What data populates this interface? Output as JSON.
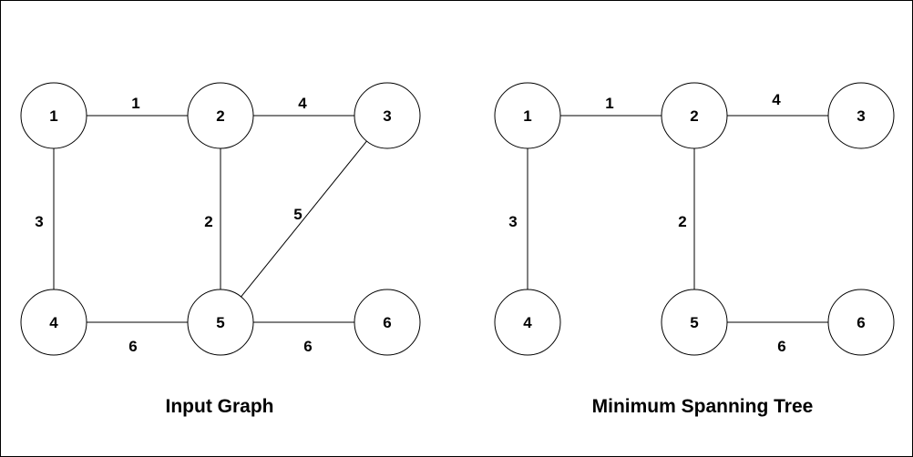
{
  "diagrams": [
    {
      "title": "Input Graph",
      "nodes": [
        "1",
        "2",
        "3",
        "4",
        "5",
        "6"
      ],
      "edges": [
        {
          "from": "1",
          "to": "2",
          "weight": "1"
        },
        {
          "from": "2",
          "to": "3",
          "weight": "4"
        },
        {
          "from": "1",
          "to": "4",
          "weight": "3"
        },
        {
          "from": "2",
          "to": "5",
          "weight": "2"
        },
        {
          "from": "3",
          "to": "5",
          "weight": "5"
        },
        {
          "from": "4",
          "to": "5",
          "weight": "6"
        },
        {
          "from": "5",
          "to": "6",
          "weight": "6"
        }
      ]
    },
    {
      "title": "Minimum Spanning Tree",
      "nodes": [
        "1",
        "2",
        "3",
        "4",
        "5",
        "6"
      ],
      "edges": [
        {
          "from": "1",
          "to": "2",
          "weight": "1"
        },
        {
          "from": "2",
          "to": "3",
          "weight": "4"
        },
        {
          "from": "1",
          "to": "4",
          "weight": "3"
        },
        {
          "from": "2",
          "to": "5",
          "weight": "2"
        },
        {
          "from": "5",
          "to": "6",
          "weight": "6"
        }
      ]
    }
  ],
  "colors": {
    "stroke": "#000000",
    "background": "#ffffff"
  }
}
